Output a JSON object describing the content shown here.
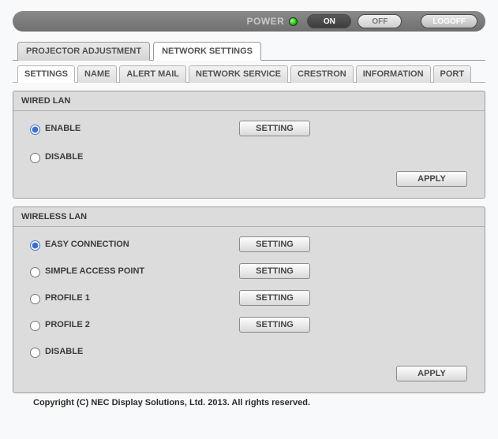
{
  "topbar": {
    "power_label": "POWER",
    "on_label": "ON",
    "off_label": "OFF",
    "logoff_label": "LOGOFF"
  },
  "tabs_level1": {
    "projector_adjustment": "PROJECTOR ADJUSTMENT",
    "network_settings": "NETWORK SETTINGS",
    "active": "network_settings"
  },
  "tabs_level2": {
    "settings": "SETTINGS",
    "name": "NAME",
    "alert_mail": "ALERT MAIL",
    "network_service": "NETWORK SERVICE",
    "crestron": "CRESTRON",
    "information": "INFORMATION",
    "port": "PORT",
    "active": "settings"
  },
  "wired_lan": {
    "title": "WIRED LAN",
    "enable_label": "ENABLE",
    "disable_label": "DISABLE",
    "setting_btn": "SETTING",
    "apply_btn": "APPLY",
    "selected": "enable"
  },
  "wireless_lan": {
    "title": "WIRELESS LAN",
    "easy_connection_label": "EASY CONNECTION",
    "simple_ap_label": "SIMPLE ACCESS POINT",
    "profile1_label": "PROFILE 1",
    "profile2_label": "PROFILE 2",
    "disable_label": "DISABLE",
    "setting_btn": "SETTING",
    "apply_btn": "APPLY",
    "selected": "easy_connection"
  },
  "copyright": "Copyright (C) NEC Display Solutions, Ltd. 2013. All rights reserved."
}
